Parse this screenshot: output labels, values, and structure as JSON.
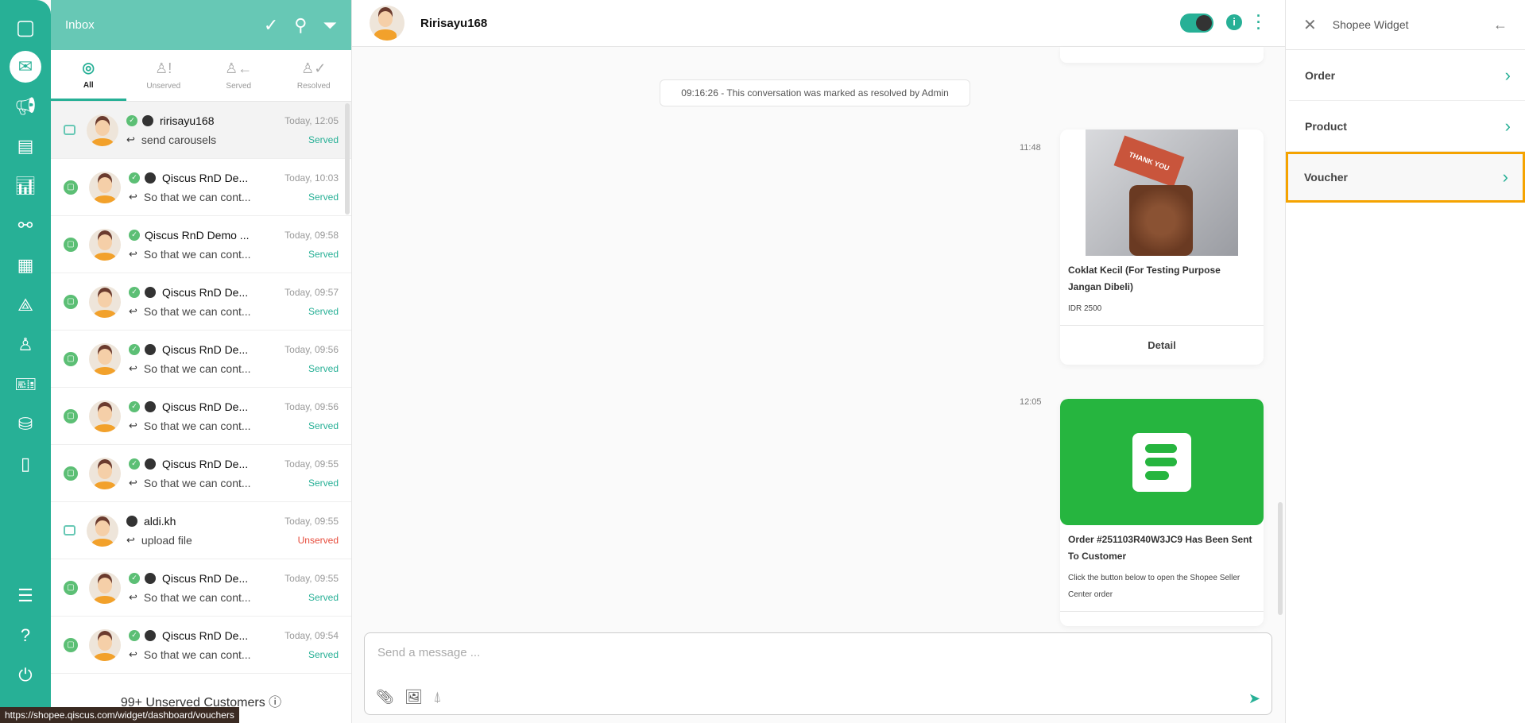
{
  "nav": {
    "items": [
      "logo",
      "inbox",
      "broadcast",
      "contacts",
      "analytics",
      "integrations",
      "apps",
      "channels",
      "agents",
      "tickets",
      "store",
      "mobile",
      "settings",
      "help",
      "logout"
    ]
  },
  "inbox": {
    "title": "Inbox",
    "tabs": [
      {
        "label": "All"
      },
      {
        "label": "Unserved"
      },
      {
        "label": "Served"
      },
      {
        "label": "Resolved"
      }
    ],
    "rooms": [
      {
        "name": "ririsayu168",
        "time": "Today, 12:05",
        "preview": "send carousels",
        "status": "Served",
        "channel": "image",
        "resolved": true,
        "bot": true
      },
      {
        "name": "Qiscus RnD De...",
        "time": "Today, 10:03",
        "preview": "So that we can cont...",
        "status": "Served",
        "channel": "qiscus",
        "resolved": true,
        "bot": true
      },
      {
        "name": "Qiscus RnD Demo ...",
        "time": "Today, 09:58",
        "preview": "So that we can cont...",
        "status": "Served",
        "channel": "qiscus",
        "resolved": true,
        "bot": false
      },
      {
        "name": "Qiscus RnD De...",
        "time": "Today, 09:57",
        "preview": "So that we can cont...",
        "status": "Served",
        "channel": "qiscus",
        "resolved": true,
        "bot": true
      },
      {
        "name": "Qiscus RnD De...",
        "time": "Today, 09:56",
        "preview": "So that we can cont...",
        "status": "Served",
        "channel": "qiscus",
        "resolved": true,
        "bot": true
      },
      {
        "name": "Qiscus RnD De...",
        "time": "Today, 09:56",
        "preview": "So that we can cont...",
        "status": "Served",
        "channel": "qiscus",
        "resolved": true,
        "bot": true
      },
      {
        "name": "Qiscus RnD De...",
        "time": "Today, 09:55",
        "preview": "So that we can cont...",
        "status": "Served",
        "channel": "qiscus",
        "resolved": true,
        "bot": true
      },
      {
        "name": "aldi.kh",
        "time": "Today, 09:55",
        "preview": "upload file",
        "status": "Unserved",
        "channel": "image",
        "resolved": false,
        "bot": true
      },
      {
        "name": "Qiscus RnD De...",
        "time": "Today, 09:55",
        "preview": "So that we can cont...",
        "status": "Served",
        "channel": "qiscus",
        "resolved": true,
        "bot": true
      },
      {
        "name": "Qiscus RnD De...",
        "time": "Today, 09:54",
        "preview": "So that we can cont...",
        "status": "Served",
        "channel": "qiscus",
        "resolved": true,
        "bot": true
      }
    ],
    "unserved_label": "99+ Unserved Customers"
  },
  "status_url": "https://shopee.qiscus.com/widget/dashboard/vouchers",
  "chat": {
    "name": "Ririsayu168",
    "notice": "09:16:26 - This conversation was marked as resolved by Admin",
    "messages": [
      {
        "time": "11:48",
        "title": "Coklat Kecil (For Testing Purpose Jangan Dibeli)",
        "price": "IDR 2500",
        "button": "Detail",
        "image_text": "THANK YOU"
      },
      {
        "time": "12:05",
        "title": "Order #251103R40W3JC9 Has Been Sent To Customer",
        "desc": "Click the button below to open the Shopee Seller Center order"
      }
    ],
    "input_placeholder": "Send a message ..."
  },
  "widget": {
    "title": "Shopee Widget",
    "items": [
      "Order",
      "Product",
      "Voucher"
    ]
  },
  "colors": {
    "primary": "#27b096",
    "highlight": "#f5a300",
    "order_green": "#26b53f"
  }
}
